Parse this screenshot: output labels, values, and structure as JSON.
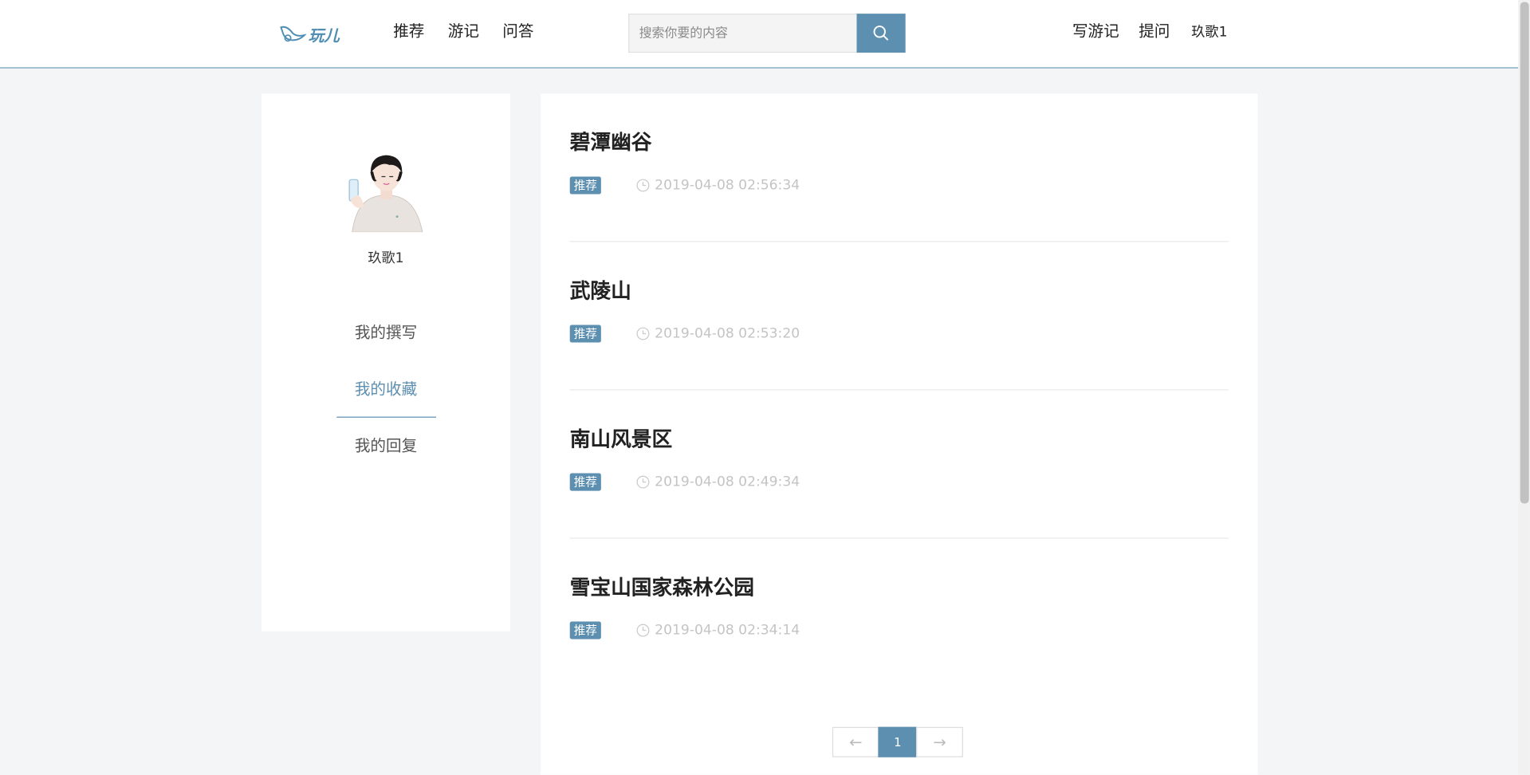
{
  "header": {
    "logo_text": "玩儿",
    "nav": [
      "推荐",
      "游记",
      "问答"
    ],
    "search_placeholder": "搜索你要的内容",
    "write_label": "写游记",
    "ask_label": "提问",
    "username": "玖歌1"
  },
  "sidebar": {
    "username": "玖歌1",
    "menu": [
      {
        "label": "我的撰写",
        "active": false
      },
      {
        "label": "我的收藏",
        "active": true
      },
      {
        "label": "我的回复",
        "active": false
      }
    ]
  },
  "articles": [
    {
      "title": "碧潭幽谷",
      "tag": "推荐",
      "time": "2019-04-08 02:56:34"
    },
    {
      "title": "武陵山",
      "tag": "推荐",
      "time": "2019-04-08 02:53:20"
    },
    {
      "title": "南山风景区",
      "tag": "推荐",
      "time": "2019-04-08 02:49:34"
    },
    {
      "title": "雪宝山国家森林公园",
      "tag": "推荐",
      "time": "2019-04-08 02:34:14"
    }
  ],
  "pagination": {
    "prev": "←",
    "current": "1",
    "next": "→"
  },
  "colors": {
    "accent": "#5d8fb0",
    "background": "#f4f5f6"
  }
}
